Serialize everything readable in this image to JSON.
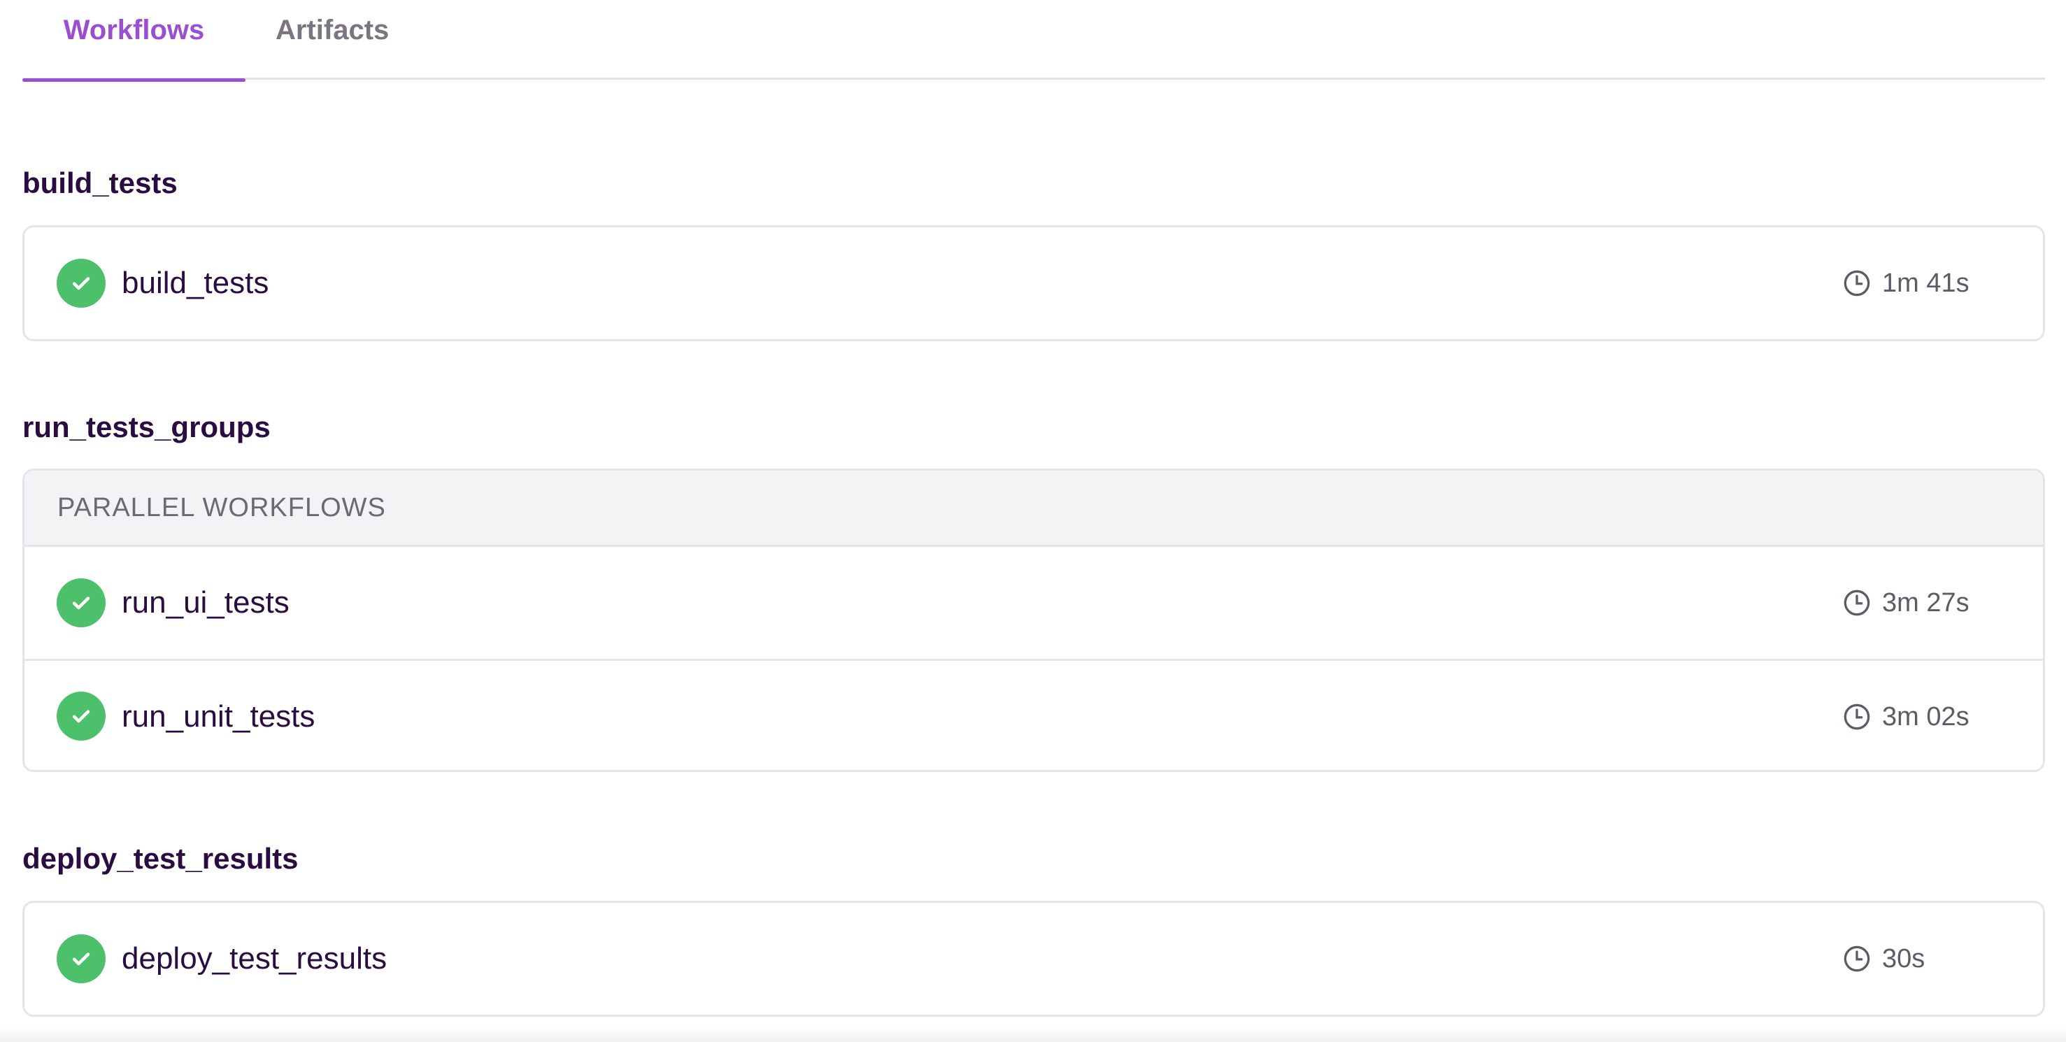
{
  "tabs": [
    {
      "label": "Workflows",
      "active": true
    },
    {
      "label": "Artifacts",
      "active": false
    }
  ],
  "colors": {
    "accent": "#9a4fd0",
    "success": "#4cc06a",
    "heading": "#2a0c40"
  },
  "groups": [
    {
      "title": "build_tests",
      "workflows": [
        {
          "name": "build_tests",
          "status": "success",
          "status_icon": "check-circle-icon",
          "duration": "1m 41s"
        }
      ]
    },
    {
      "title": "run_tests_groups",
      "header": "PARALLEL WORKFLOWS",
      "workflows": [
        {
          "name": "run_ui_tests",
          "status": "success",
          "status_icon": "check-circle-icon",
          "duration": "3m 27s"
        },
        {
          "name": "run_unit_tests",
          "status": "success",
          "status_icon": "check-circle-icon",
          "duration": "3m 02s"
        }
      ]
    },
    {
      "title": "deploy_test_results",
      "workflows": [
        {
          "name": "deploy_test_results",
          "status": "success",
          "status_icon": "check-circle-icon",
          "duration": "30s"
        }
      ]
    }
  ],
  "icons": {
    "duration": "clock-icon"
  }
}
